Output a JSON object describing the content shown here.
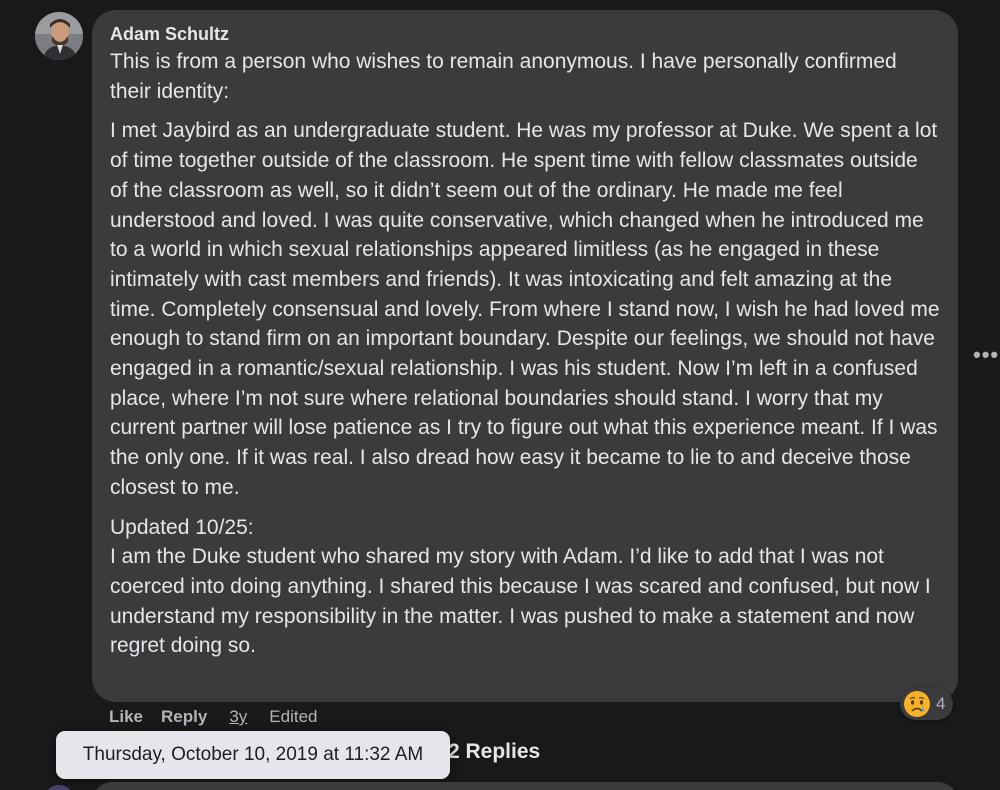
{
  "comment": {
    "author": "Adam Schultz",
    "paragraphs": [
      "This is from a person who wishes to remain anonymous. I have personally confirmed their identity:",
      "I met Jaybird as an undergraduate student. He was my professor at Duke. We spent a lot of time together outside of the classroom. He spent time with fellow classmates outside of the classroom as well, so it didn’t seem out of the ordinary. He made me feel understood and loved. I was quite conservative, which changed when he introduced me to a world in which sexual relationships appeared limitless (as he engaged in these intimately with cast members and friends). It was intoxicating and felt amazing at the time. Completely consensual and lovely. From where I stand now, I wish he had loved me enough to stand firm on an important boundary. Despite our feelings, we should not have engaged in a romantic/sexual relationship. I was his student. Now I’m left in a confused place, where I’m not sure where relational boundaries should stand. I worry that my current partner will lose patience as I try to figure out what this experience meant. If I was the only one. If it was real. I also dread how easy it became to lie to and deceive those closest to me.",
      "Updated 10/25:\nI am the Duke student who shared my story with Adam. I’d like to add that I was not coerced into doing anything. I shared this because I was scared and confused, but now I understand my responsibility in the matter. I was pushed to make a statement and now regret doing so."
    ],
    "reaction": {
      "icon": "sad-face-icon",
      "count": "4"
    },
    "actions": {
      "like": "Like",
      "reply": "Reply",
      "time": "3y",
      "edited": "Edited"
    },
    "more_icon": "more-options-icon"
  },
  "replies": {
    "label": "2 Replies"
  },
  "tooltip": {
    "text": "Thursday, October 10, 2019 at 11:32 AM"
  },
  "colors": {
    "background": "#18191a",
    "bubble": "#3a3b3c",
    "text_primary": "#e4e6eb",
    "text_secondary": "#b0b3b8",
    "tooltip_bg": "#e4e6eb"
  }
}
